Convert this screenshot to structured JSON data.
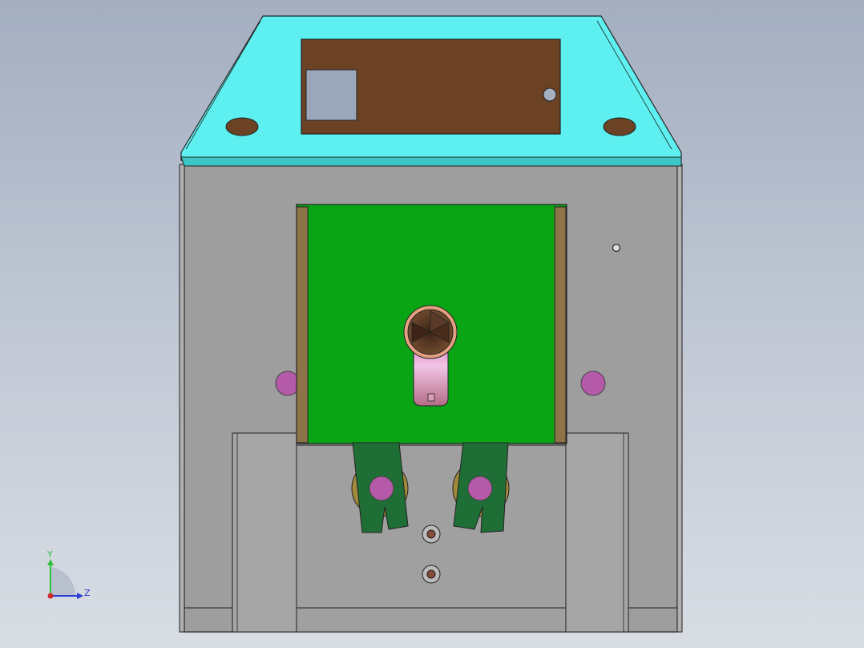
{
  "viewport": {
    "background_top": "#a3aec0",
    "background_bottom": "#d9dde4"
  },
  "model": {
    "colors": {
      "body": "#9e9e9e",
      "body_dark": "#8c8c8c",
      "top_cover": "#5ef0f0",
      "top_cover_edge": "#3cc6c6",
      "brown_plate": "#6b4324",
      "green_plate": "#0aa514",
      "tan_rail": "#8c7448",
      "purple_pin": "#b45aa8",
      "dark_green_arm": "#1f6e36",
      "gold_washer": "#a08a3a",
      "pink_slot": "#c88ca0"
    }
  },
  "triad": {
    "y_label": "Y",
    "z_label": "Z",
    "y_color": "#2fbf3f",
    "z_color": "#2b3fd6",
    "origin_color": "#d22a2a"
  }
}
